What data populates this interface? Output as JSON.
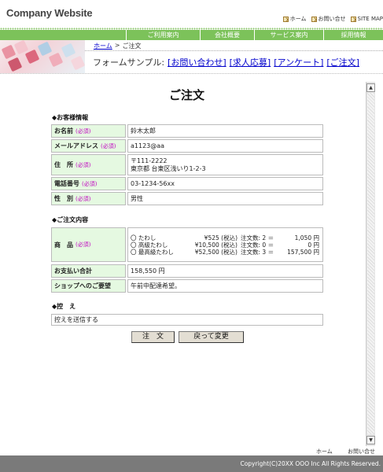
{
  "header": {
    "logo": "Company Website",
    "links": [
      {
        "label": "ホーム",
        "icon": "arrow-icon"
      },
      {
        "label": "お問い合せ",
        "icon": "arrow-icon"
      },
      {
        "label": "SITE MAP",
        "icon": "arrow-icon"
      }
    ]
  },
  "nav": {
    "items": [
      "ご利用案内",
      "会社概要",
      "サービス案内",
      "採用情報"
    ],
    "color": "#7cc25a"
  },
  "breadcrumb": {
    "home": "ホーム",
    "separator": ">",
    "current": "ご注文"
  },
  "form_samples": {
    "label": "フォームサンプル:",
    "links": [
      "[お問い合わせ]",
      "[求人応募]",
      "[アンケート]",
      "[ご注文]"
    ]
  },
  "page": {
    "title": "ご注文"
  },
  "customer": {
    "title": "◆お客様情報",
    "rows": [
      {
        "label": "お名前",
        "required": "(必須)",
        "value": "鈴木太郎"
      },
      {
        "label": "メールアドレス",
        "required": "(必須)",
        "value": "a1123@aa"
      },
      {
        "label": "住　所",
        "required": "(必須)",
        "lines": [
          "〒111-2222",
          "東京都 台東区浅いり1-2-3"
        ]
      },
      {
        "label": "電話番号",
        "required": "(必須)",
        "value": "03-1234-56xx"
      },
      {
        "label": "性　別",
        "required": "(必須)",
        "value": "男性"
      }
    ]
  },
  "order": {
    "title": "◆ご注文内容",
    "product_label": "商　品",
    "required": "(必須)",
    "products": [
      {
        "name": "〇 たわし",
        "price": "¥525 (税込)",
        "qty": "注文数: 2 ＝",
        "total": "1,050 円"
      },
      {
        "name": "〇 高級たわし",
        "price": "¥10,500 (税込)",
        "qty": "注文数: 0 ＝",
        "total": "0 円"
      },
      {
        "name": "〇 最高級たわし",
        "price": "¥52,500 (税込)",
        "qty": "注文数: 3 ＝",
        "total": "157,500 円"
      }
    ],
    "total_label": "お支払い合計",
    "total_value": "158,550 円",
    "request_label": "ショップへのご要望",
    "request_value": "午前中配達希望。"
  },
  "memo": {
    "title": "◆控　え",
    "value": "控えを送信する"
  },
  "buttons": {
    "submit": "注　文",
    "back": "戻って変更"
  },
  "footer": {
    "links": [
      "ホーム",
      "お問い合せ"
    ],
    "copyright": "Copyright(C)20XX OOO Inc All Rights Reserved."
  },
  "colors": {
    "label_bg": "#e5f9e1",
    "required": "#c000c0",
    "footer_bg": "#7a7a7a"
  }
}
